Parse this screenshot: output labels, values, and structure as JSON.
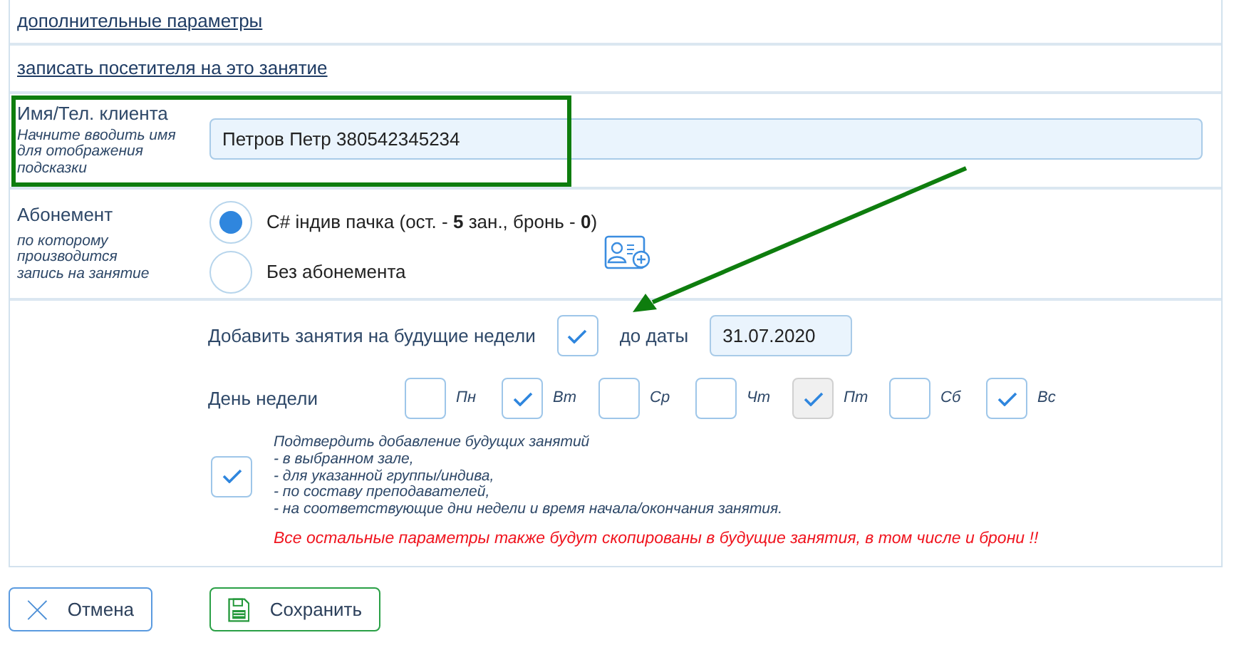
{
  "links": [
    {
      "text": "дополнительные параметры"
    },
    {
      "text": "записать посетителя на это занятие"
    }
  ],
  "client": {
    "label": "Имя/Тел. клиента",
    "hint": "Начните вводить имя для отображения подсказки",
    "value": "Петров Петр 380542345234"
  },
  "subscription": {
    "label": "Абонемент",
    "hint": "по которому производится запись на занятие",
    "options": [
      {
        "text": "C# індив пачка (ост. - **5** зан., бронь - **0**)",
        "selected": true
      },
      {
        "text": "Без абонемента",
        "selected": false
      }
    ]
  },
  "future": {
    "label": "Добавить занятия на будущие недели",
    "checked": true,
    "date_label": "до даты",
    "date": "31.07.2020",
    "weekday_label": "День недели",
    "days": [
      {
        "label": "Пн",
        "checked": false,
        "disabled": false
      },
      {
        "label": "Вт",
        "checked": true,
        "disabled": false
      },
      {
        "label": "Ср",
        "checked": false,
        "disabled": false
      },
      {
        "label": "Чт",
        "checked": false,
        "disabled": false
      },
      {
        "label": "Пт",
        "checked": true,
        "disabled": true
      },
      {
        "label": "Сб",
        "checked": false,
        "disabled": false
      },
      {
        "label": "Вс",
        "checked": true,
        "disabled": false
      }
    ],
    "confirm": {
      "checked": true,
      "lines": [
        "Подтвердить добавление будущих занятий",
        "- в выбранном зале,",
        "- для указанной группы/индива,",
        "- по составу преподавателей,",
        "- на соответствующие дни недели и время начала/окончания занятия."
      ]
    },
    "warning": "Все остальные параметры также будут скопированы в будущие занятия, в том числе и брони !!"
  },
  "buttons": [
    {
      "kind": "cancel",
      "label": "Отмена"
    },
    {
      "kind": "save",
      "label": "Сохранить"
    }
  ]
}
